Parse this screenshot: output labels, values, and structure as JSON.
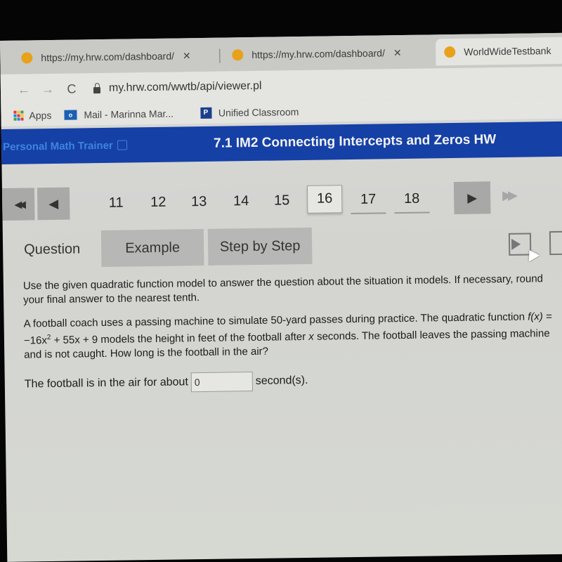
{
  "browser": {
    "tabs": [
      {
        "label": "https://my.hrw.com/dashboard/",
        "active": false
      },
      {
        "label": "https://my.hrw.com/dashboard/",
        "active": false
      },
      {
        "label": "WorldWideTestbank",
        "active": true
      }
    ],
    "close_glyph": "✕",
    "nav": {
      "back": "←",
      "forward": "→",
      "reload": "C"
    },
    "url": "my.hrw.com/wwtb/api/viewer.pl",
    "bookmarks": [
      {
        "label": "Apps",
        "icon": "apps-icon"
      },
      {
        "label": "Mail - Marinna Mar...",
        "icon": "mail-icon",
        "icon_text": "o"
      },
      {
        "label": "Unified Classroom",
        "icon": "unified-classroom-icon",
        "icon_text": "P"
      }
    ]
  },
  "app": {
    "brand": "Personal Math Trainer",
    "title": "7.1 IM2 Connecting Intercepts and Zeros HW",
    "header_color": "#1540a6"
  },
  "pager": {
    "first": "◀◀",
    "prev": "◀",
    "next": "▶",
    "last": "▶▶",
    "pages": [
      "11",
      "12",
      "13",
      "14",
      "15",
      "16",
      "17",
      "18"
    ],
    "current": "16"
  },
  "tabs": {
    "question": "Question",
    "example": "Example",
    "step_by_step": "Step by Step"
  },
  "question": {
    "instructions": "Use the given quadratic function model to answer the question about the situation it models. If necessary, round your final answer to the nearest tenth.",
    "problem_part1": "A football coach uses a passing machine to simulate 50-yard passes during practice. The quadratic function ",
    "function_name": "f(x)",
    "equation_part1": " = −16x",
    "exponent": "2",
    "equation_part2": " + 55x + 9",
    "problem_part2": " models the height in feet of the football after ",
    "variable": "x",
    "problem_part3": " seconds. The football leaves the passing machine and is not caught. How long is the football in the air?",
    "answer_prefix": "The football is in the air for about",
    "answer_value": "0",
    "answer_suffix": "second(s)."
  }
}
